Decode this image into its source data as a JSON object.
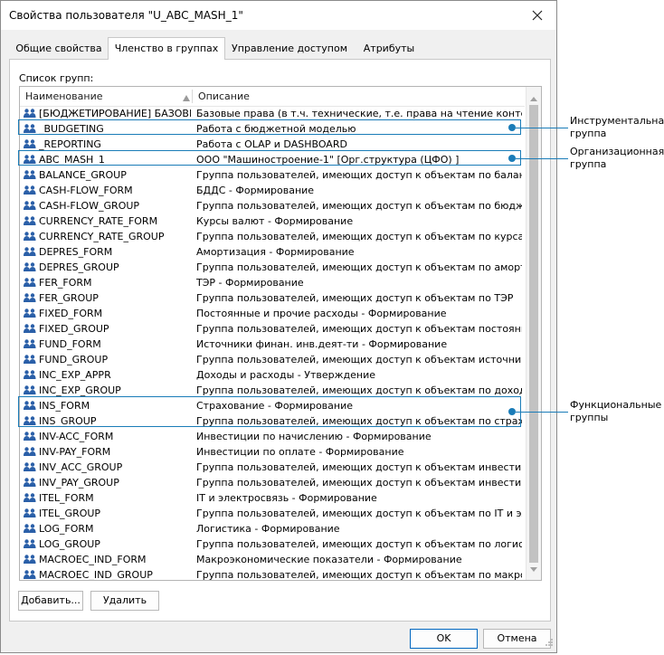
{
  "window": {
    "title": "Свойства пользователя \"U_ABC_MASH_1\""
  },
  "tabs": [
    {
      "label": "Общие свойства"
    },
    {
      "label": "Членство в группах"
    },
    {
      "label": "Управление доступом"
    },
    {
      "label": "Атрибуты"
    }
  ],
  "groups": {
    "list_label": "Список групп:",
    "columns": {
      "name": "Наименование",
      "description": "Описание"
    },
    "rows": [
      {
        "name": "[БЮДЖЕТИРОВАНИЕ] БАЗОВЫЕ ПРАВА",
        "desc": "Базовые права (в т.ч. технические, т.е. права на чтение контейнеров)"
      },
      {
        "name": "_BUDGETING",
        "desc": "Работа с бюджетной моделью"
      },
      {
        "name": "_REPORTING",
        "desc": "Работа с OLAP и DASHBOARD"
      },
      {
        "name": "ABC_MASH_1",
        "desc": "ООО \"Машиностроение-1\" [Орг.структура (ЦФО) ]"
      },
      {
        "name": "BALANCE_GROUP",
        "desc": "Группа пользователей, имеющих доступ к объектам по балансу"
      },
      {
        "name": "CASH-FLOW_FORM",
        "desc": "БДДС - Формирование"
      },
      {
        "name": "CASH-FLOW_GROUP",
        "desc": "Группа пользователей, имеющих доступ к объектам по бюджету движения"
      },
      {
        "name": "CURRENCY_RATE_FORM",
        "desc": "Курсы валют - Формирование"
      },
      {
        "name": "CURRENCY_RATE_GROUP",
        "desc": "Группа пользователей, имеющих доступ к объектам по курсам валют"
      },
      {
        "name": "DEPRES_FORM",
        "desc": "Амортизация - Формирование"
      },
      {
        "name": "DEPRES_GROUP",
        "desc": "Группа пользователей, имеющих доступ к объектам по амортизации"
      },
      {
        "name": "FER_FORM",
        "desc": "ТЭР - Формирование"
      },
      {
        "name": "FER_GROUP",
        "desc": "Группа пользователей, имеющих доступ к объектам по ТЭР"
      },
      {
        "name": "FIXED_FORM",
        "desc": "Постоянные и прочие расходы - Формирование"
      },
      {
        "name": "FIXED_GROUP",
        "desc": "Группа пользователей, имеющих доступ к объектам постоянных расходов"
      },
      {
        "name": "FUND_FORM",
        "desc": "Источники финан. инв.деят-ти - Формирование"
      },
      {
        "name": "FUND_GROUP",
        "desc": "Группа пользователей, имеющих доступ к объектам источников финансирования"
      },
      {
        "name": "INC_EXP_APPR",
        "desc": "Доходы и расходы - Утверждение"
      },
      {
        "name": "INC_EXP_GROUP",
        "desc": "Группа пользователей, имеющих доступ к объектам по доходам и расходам"
      },
      {
        "name": "INS_FORM",
        "desc": "Страхование - Формирование"
      },
      {
        "name": "INS_GROUP",
        "desc": "Группа пользователей, имеющих доступ к объектам по страхованию"
      },
      {
        "name": "INV-ACC_FORM",
        "desc": "Инвестиции по начислению - Формирование"
      },
      {
        "name": "INV-PAY_FORM",
        "desc": "Инвестиции по оплате - Формирование"
      },
      {
        "name": "INV_ACC_GROUP",
        "desc": "Группа пользователей, имеющих доступ к объектам инвестиций по начислению"
      },
      {
        "name": "INV_PAY_GROUP",
        "desc": "Группа пользователей, имеющих доступ к объектам инвестиций по оплате"
      },
      {
        "name": "ITEL_FORM",
        "desc": "IT и электросвязь - Формирование"
      },
      {
        "name": "ITEL_GROUP",
        "desc": "Группа пользователей, имеющих доступ к объектам по IT и электросвязи"
      },
      {
        "name": "LOG_FORM",
        "desc": "Логистика - Формирование"
      },
      {
        "name": "LOG_GROUP",
        "desc": "Группа пользователей, имеющих доступ к объектам по логистике"
      },
      {
        "name": "MACROEC_IND_FORM",
        "desc": "Макроэкономические показатели - Формирование"
      },
      {
        "name": "MACROEC_IND_GROUP",
        "desc": "Группа пользователей, имеющих доступ к объектам по макроэкономике"
      }
    ]
  },
  "buttons": {
    "add": "Добавить...",
    "delete": "Удалить",
    "ok": "OK",
    "cancel": "Отмена"
  },
  "callouts": {
    "tool": "Инструментальная\nгруппа",
    "org": "Организационная\nгруппа",
    "func": "Функциональные\nгруппы"
  },
  "colors": {
    "accent": "#1a7cb8",
    "icon": "#2a5fa8",
    "primary_border": "#0067c0"
  }
}
